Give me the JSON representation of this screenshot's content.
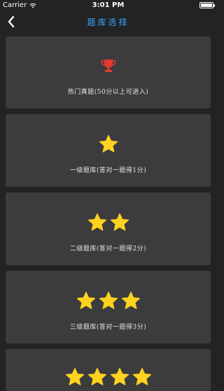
{
  "status_bar": {
    "carrier": "Carrier",
    "time": "3:01 PM",
    "battery_level": 1.0
  },
  "nav": {
    "title": "题库选择",
    "back_icon": "chevron-left-icon"
  },
  "colors": {
    "background": "#232323",
    "card": "#3c3c3e",
    "title": "#37a3ff",
    "star": "#ffd21f",
    "trophy": "#e23a2e"
  },
  "cards": [
    {
      "label": "热门真题(50分以上可进入)",
      "icon": "trophy-icon",
      "stars": 0
    },
    {
      "label": "一级题库(答对一题得1分)",
      "icon": "star-icon",
      "stars": 1
    },
    {
      "label": "二级题库(答对一题得2分)",
      "icon": "star-icon",
      "stars": 2
    },
    {
      "label": "三级题库(答对一题得3分)",
      "icon": "star-icon",
      "stars": 3
    },
    {
      "label": "",
      "icon": "star-icon",
      "stars": 4
    }
  ]
}
